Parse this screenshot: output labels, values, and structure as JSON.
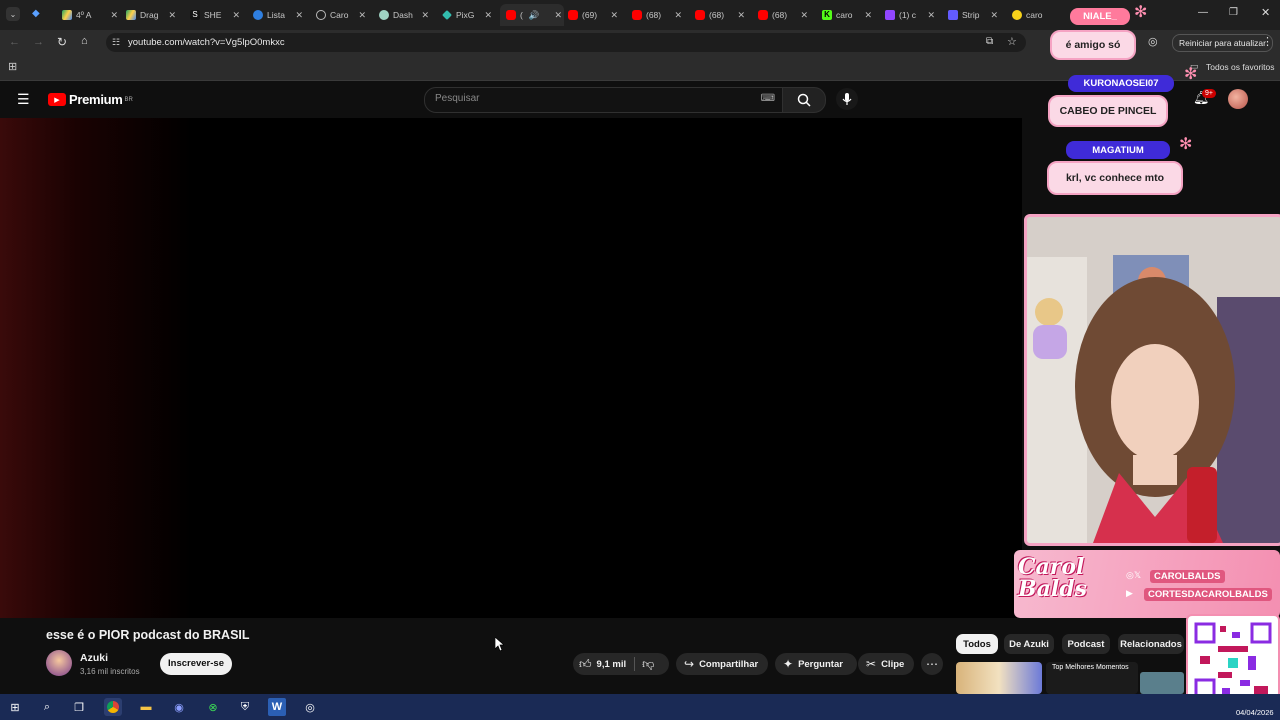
{
  "browser": {
    "tabs": [
      {
        "label": "4º A"
      },
      {
        "label": "Drag"
      },
      {
        "label": "SHE"
      },
      {
        "label": "Lista"
      },
      {
        "label": "Caro"
      },
      {
        "label": "Dash"
      },
      {
        "label": "PixG"
      },
      {
        "label": "("
      },
      {
        "label": "(69)"
      },
      {
        "label": "(68)"
      },
      {
        "label": "(68)"
      },
      {
        "label": "(68)"
      },
      {
        "label": "caro"
      },
      {
        "label": "(1) c"
      },
      {
        "label": "Strip"
      },
      {
        "label": "caro"
      }
    ],
    "url": "youtube.com/watch?v=Vg5lpO0mkxc",
    "restart_label": "Reiniciar para atualizar",
    "bookmarks_label": "Todos os favoritos"
  },
  "youtube": {
    "logo_text": "Premium",
    "logo_badge": "BR",
    "search_placeholder": "Pesquisar",
    "notif_count": "9+",
    "video_title": "esse é o PIOR podcast do BRASIL",
    "channel_name": "Azuki",
    "subscribers": "3,16 mil inscritos",
    "subscribe_label": "Inscrever-se",
    "likes": "9,1 mil",
    "share_label": "Compartilhar",
    "ask_label": "Perguntar",
    "clip_label": "Clipe",
    "chips": [
      "Todos",
      "De Azuki",
      "Podcast",
      "Relacionados"
    ],
    "thumb_text": "Top Melhores Momentos"
  },
  "overlay": {
    "chat": [
      {
        "user": "NIALE_",
        "message": "é amigo só"
      },
      {
        "user": "KURONAOSEI07",
        "message": "CABEO DE PINCEL"
      },
      {
        "user": "MAGATIUM",
        "message": "krl, vc conhece mto"
      }
    ],
    "brand": "Carol Balds",
    "socials": [
      "CAROLBALDS",
      "CORTESDACAROLBALDS"
    ]
  },
  "taskbar": {
    "date": "04/04/2026"
  },
  "colors": {
    "yt_red": "#ff0000",
    "pink_frame": "#f5a3c3",
    "chat_tag": "#3f2bd8",
    "taskbar": "#1a2a55"
  }
}
